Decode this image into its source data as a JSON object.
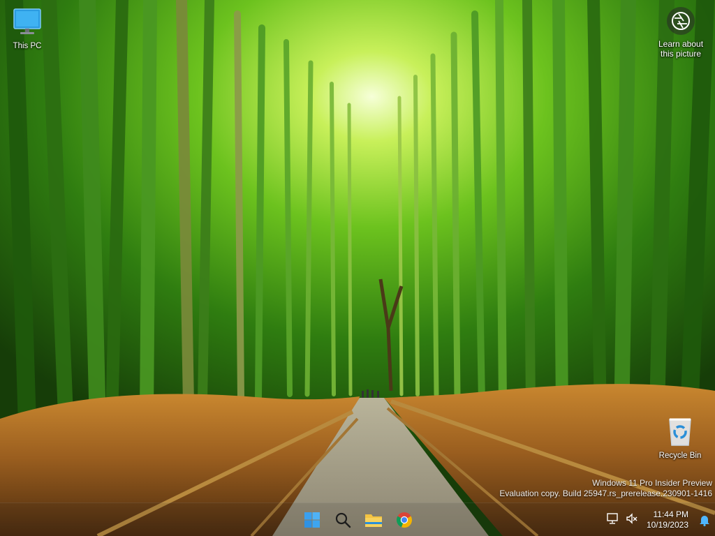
{
  "desktop": {
    "icons": [
      {
        "label": "This PC",
        "icon": "computer-icon"
      },
      {
        "label": "Recycle Bin",
        "icon": "recycle-bin-icon"
      }
    ],
    "spotlight": {
      "line1": "Learn about",
      "line2": "this picture",
      "icon": "spotlight-camera-icon"
    },
    "watermark": {
      "line1": "Windows 11 Pro Insider Preview",
      "line2": "Evaluation copy. Build 25947.rs_prerelease.230901-1416"
    }
  },
  "taskbar": {
    "pinned": [
      {
        "name": "start",
        "icon": "windows-logo-icon"
      },
      {
        "name": "search",
        "icon": "search-icon"
      },
      {
        "name": "file-explorer",
        "icon": "folder-icon"
      },
      {
        "name": "chrome",
        "icon": "chrome-icon"
      }
    ],
    "tray": {
      "icons": [
        "network-icon",
        "speaker-muted-icon"
      ],
      "time": "11:44 PM",
      "date": "10/19/2023",
      "notification_icon": "bell-icon"
    }
  },
  "colors": {
    "accent": "#0078d4",
    "windows_logo": "#3aa0f0",
    "folder": "#f3c342"
  }
}
